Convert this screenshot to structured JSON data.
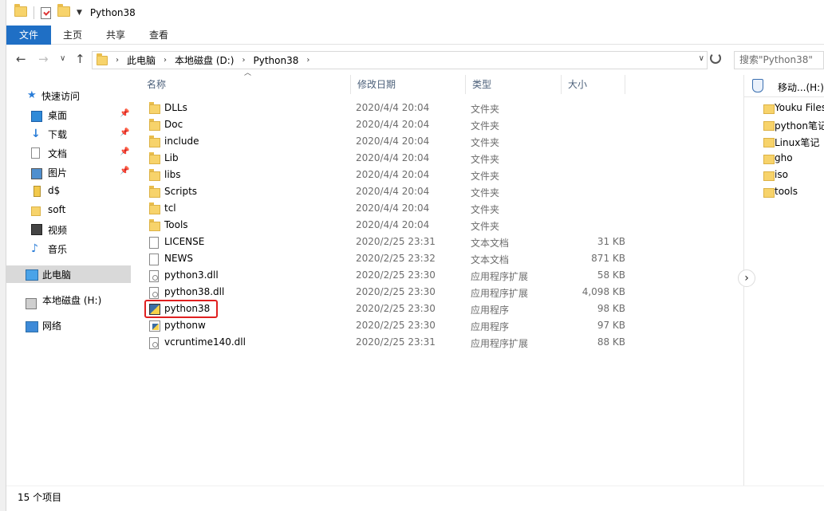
{
  "window": {
    "title": "Python38"
  },
  "ribbon": {
    "tabs": [
      "文件",
      "主页",
      "共享",
      "查看"
    ]
  },
  "address": {
    "breadcrumbs": [
      "此电脑",
      "本地磁盘 (D:)",
      "Python38"
    ],
    "search_placeholder": "搜索\"Python38\""
  },
  "nav": {
    "quick_access": "快速访问",
    "items": [
      {
        "label": "桌面",
        "icon": "desktop-icon",
        "pinned": true
      },
      {
        "label": "下载",
        "icon": "download-icon",
        "pinned": true
      },
      {
        "label": "文档",
        "icon": "document-icon",
        "pinned": true
      },
      {
        "label": "图片",
        "icon": "pictures-icon",
        "pinned": true
      },
      {
        "label": "d$",
        "icon": "drive-share-icon",
        "pinned": false
      },
      {
        "label": "soft",
        "icon": "folder-icon",
        "pinned": false
      },
      {
        "label": "视频",
        "icon": "video-icon",
        "pinned": false
      },
      {
        "label": "音乐",
        "icon": "music-icon",
        "pinned": false
      }
    ],
    "this_pc": "此电脑",
    "local_disk": "本地磁盘 (H:)",
    "network": "网络"
  },
  "columns": {
    "name": "名称",
    "date": "修改日期",
    "type": "类型",
    "size": "大小"
  },
  "files": [
    {
      "name": "DLLs",
      "date": "2020/4/4 20:04",
      "type": "文件夹",
      "size": "",
      "icon": "folder"
    },
    {
      "name": "Doc",
      "date": "2020/4/4 20:04",
      "type": "文件夹",
      "size": "",
      "icon": "folder"
    },
    {
      "name": "include",
      "date": "2020/4/4 20:04",
      "type": "文件夹",
      "size": "",
      "icon": "folder"
    },
    {
      "name": "Lib",
      "date": "2020/4/4 20:04",
      "type": "文件夹",
      "size": "",
      "icon": "folder"
    },
    {
      "name": "libs",
      "date": "2020/4/4 20:04",
      "type": "文件夹",
      "size": "",
      "icon": "folder"
    },
    {
      "name": "Scripts",
      "date": "2020/4/4 20:04",
      "type": "文件夹",
      "size": "",
      "icon": "folder"
    },
    {
      "name": "tcl",
      "date": "2020/4/4 20:04",
      "type": "文件夹",
      "size": "",
      "icon": "folder"
    },
    {
      "name": "Tools",
      "date": "2020/4/4 20:04",
      "type": "文件夹",
      "size": "",
      "icon": "folder"
    },
    {
      "name": "LICENSE",
      "date": "2020/2/25 23:31",
      "type": "文本文档",
      "size": "31 KB",
      "icon": "txt"
    },
    {
      "name": "NEWS",
      "date": "2020/2/25 23:32",
      "type": "文本文档",
      "size": "871 KB",
      "icon": "txt"
    },
    {
      "name": "python3.dll",
      "date": "2020/2/25 23:30",
      "type": "应用程序扩展",
      "size": "58 KB",
      "icon": "dll"
    },
    {
      "name": "python38.dll",
      "date": "2020/2/25 23:30",
      "type": "应用程序扩展",
      "size": "4,098 KB",
      "icon": "dll"
    },
    {
      "name": "python38",
      "date": "2020/2/25 23:30",
      "type": "应用程序",
      "size": "98 KB",
      "icon": "py"
    },
    {
      "name": "pythonw",
      "date": "2020/2/25 23:30",
      "type": "应用程序",
      "size": "97 KB",
      "icon": "pyw"
    },
    {
      "name": "vcruntime140.dll",
      "date": "2020/2/25 23:31",
      "type": "应用程序扩展",
      "size": "88 KB",
      "icon": "dll"
    }
  ],
  "preview": {
    "header": "移动...(H:)",
    "items": [
      "Youku Files",
      "python笔记",
      "Linux笔记",
      "gho",
      "iso",
      "tools"
    ]
  },
  "status": {
    "count": "15 个项目"
  }
}
